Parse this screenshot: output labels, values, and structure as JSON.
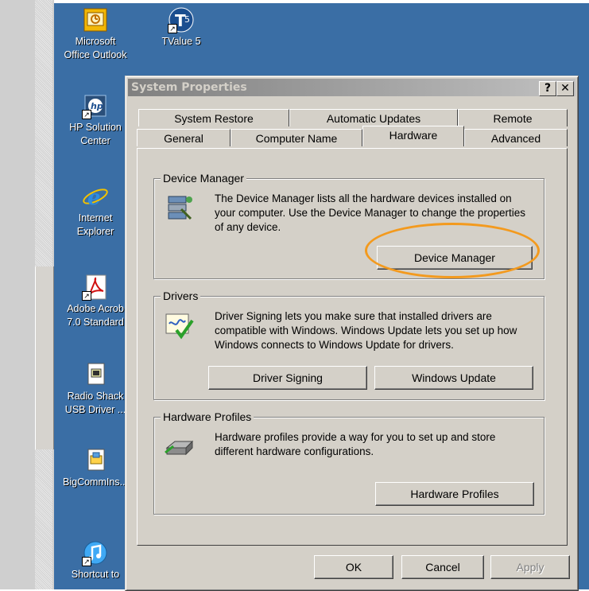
{
  "desktop_icons": [
    {
      "label": "Microsoft\nOffice Outlook",
      "icon": "outlook-icon"
    },
    {
      "label": "TValue 5",
      "icon": "tvalue-icon"
    },
    {
      "label": "HP Solution\nCenter",
      "icon": "hp-solution-center-icon"
    },
    {
      "label": "Internet\nExplorer",
      "icon": "internet-explorer-icon"
    },
    {
      "label": "Adobe Acrob\n7.0 Standard",
      "icon": "adobe-acrobat-icon"
    },
    {
      "label": "Radio Shack\nUSB Driver ...",
      "icon": "radio-shack-driver-icon"
    },
    {
      "label": "BigCommIns...",
      "icon": "bigcomm-installer-icon"
    },
    {
      "label": "Shortcut to",
      "icon": "shortcut-icon"
    }
  ],
  "dialog": {
    "title": "System Properties",
    "help_label": "?",
    "close_label": "✕",
    "tabs_back": [
      "System Restore",
      "Automatic Updates",
      "Remote"
    ],
    "tabs_front": [
      "General",
      "Computer Name",
      "Hardware",
      "Advanced"
    ],
    "active_tab": "Hardware",
    "device_manager": {
      "title": "Device Manager",
      "text": "The Device Manager lists all the hardware devices installed on your computer. Use the Device Manager to change the properties of any device.",
      "button": "Device Manager"
    },
    "drivers": {
      "title": "Drivers",
      "text": "Driver Signing lets you make sure that installed drivers are compatible with Windows. Windows Update lets you set up how Windows connects to Windows Update for drivers.",
      "button_signing": "Driver Signing",
      "button_update": "Windows Update"
    },
    "hardware_profiles": {
      "title": "Hardware Profiles",
      "text": "Hardware profiles provide a way for you to set up and store different hardware configurations.",
      "button": "Hardware Profiles"
    },
    "ok": "OK",
    "cancel": "Cancel",
    "apply": "Apply"
  },
  "colors": {
    "desktop": "#3a6ea5",
    "highlight": "#f39a1e",
    "dialog": "#d4d0c8"
  }
}
